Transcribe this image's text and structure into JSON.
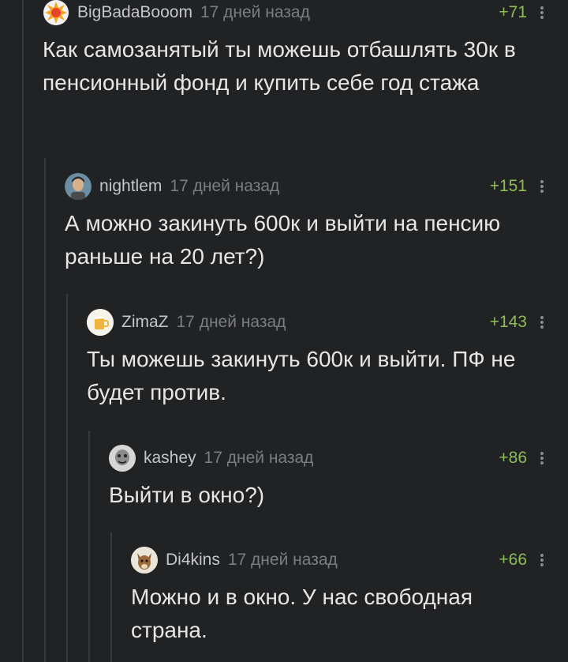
{
  "comments": [
    {
      "username": "BigBadaBooom",
      "time": "17 дней назад",
      "rating": "+71",
      "text": "Как самозанятый ты можешь отбашлять 30к в пенсионный фонд и купить себе год стажа",
      "avatar_icon": "explosion-avatar"
    },
    {
      "username": "nightlem",
      "time": "17 дней назад",
      "rating": "+151",
      "text": "А можно закинуть 600к и выйти на пенсию раньше на 20 лет?)",
      "avatar_icon": "cartoon-man-avatar"
    },
    {
      "username": "ZimaZ",
      "time": "17 дней назад",
      "rating": "+143",
      "text": "Ты можешь закинуть 600к и выйти. ПФ не будет против.",
      "avatar_icon": "beer-mug-avatar"
    },
    {
      "username": "kashey",
      "time": "17 дней назад",
      "rating": "+86",
      "text": "Выйти в окно?)",
      "avatar_icon": "bw-face-avatar"
    },
    {
      "username": "Di4kins",
      "time": "17 дней назад",
      "rating": "+66",
      "text": "Можно и в окно. У нас свободная страна.",
      "avatar_icon": "fox-avatar"
    }
  ],
  "colors": {
    "background": "#212224",
    "rating": "#8fbc5a",
    "thread_line": "#38393b"
  }
}
